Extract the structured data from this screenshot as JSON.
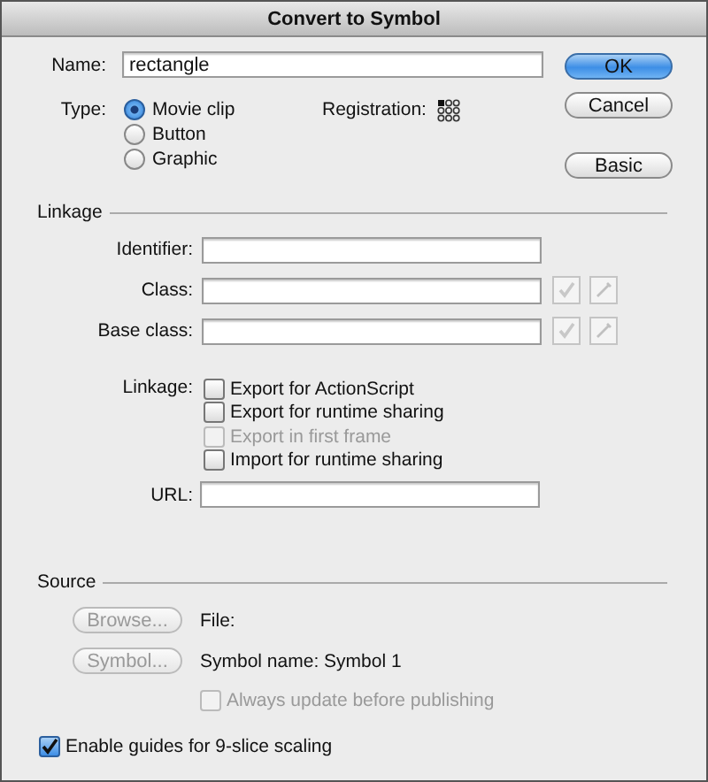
{
  "window": {
    "title": "Convert to Symbol"
  },
  "name_field": {
    "label": "Name:",
    "value": "rectangle"
  },
  "type": {
    "label": "Type:",
    "options": [
      {
        "label": "Movie clip",
        "selected": true
      },
      {
        "label": "Button",
        "selected": false
      },
      {
        "label": "Graphic",
        "selected": false
      }
    ]
  },
  "registration": {
    "label": "Registration:"
  },
  "buttons": [
    {
      "label": "OK",
      "default": true
    },
    {
      "label": "Cancel",
      "default": false
    },
    {
      "label": "Basic",
      "default": false
    }
  ],
  "linkage": {
    "title": "Linkage",
    "fields": [
      {
        "label": "Identifier:",
        "kind": "plain"
      },
      {
        "label": "Class:",
        "kind": "class"
      },
      {
        "label": "Base class:",
        "kind": "class"
      }
    ],
    "options_label": "Linkage:",
    "options": [
      {
        "label": "Export for ActionScript",
        "checked": false,
        "disabled": false
      },
      {
        "label": "Export for runtime sharing",
        "checked": false,
        "disabled": false
      },
      {
        "label": "Export in first frame",
        "checked": false,
        "disabled": true
      },
      {
        "label": "Import for runtime sharing",
        "checked": false,
        "disabled": false
      }
    ],
    "url": {
      "label": "URL:"
    }
  },
  "source": {
    "title": "Source",
    "rows": [
      {
        "button": "Browse...",
        "text": "File:",
        "disabled": true
      },
      {
        "button": "Symbol...",
        "text": "Symbol name: Symbol 1",
        "disabled": true
      }
    ],
    "always_update": {
      "label": "Always update before publishing",
      "checked": false,
      "disabled": true
    }
  },
  "enable_guides": {
    "label": "Enable guides for 9-slice scaling",
    "checked": true
  }
}
